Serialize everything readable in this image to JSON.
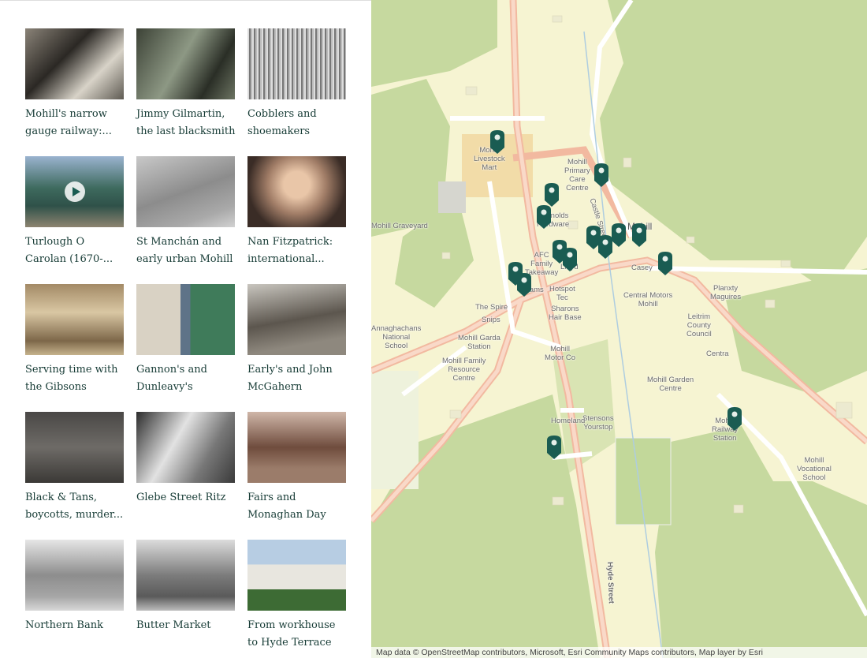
{
  "stories": [
    {
      "title": "Mohill's narrow gauge railway:...",
      "bg": "linear-gradient(135deg,#8a8378,#2b2824 40%,#d8d3c8 70%,#5e5a52)"
    },
    {
      "title": "Jimmy Gilmartin, the last blacksmith",
      "bg": "linear-gradient(120deg,#3c4236,#8d9884 45%,#2a2e26 75%,#6c7462)"
    },
    {
      "title": "Cobblers and shoemakers",
      "bg": "repeating-linear-gradient(90deg,#ddd 0 2px,#777 2px 4px,#bbb 4px 6px)"
    },
    {
      "title": "Turlough O Carolan (1670-...",
      "bg": "linear-gradient(180deg,#9ab3cf,#3e6a5e 45%,#2f5149 70%,#8d8470)",
      "video": true
    },
    {
      "title": "St Manchán and early urban Mohill",
      "bg": "linear-gradient(160deg,#c8c8c8,#8c8c8c 50%,#a9a9a9 80%,#d2d2d2)"
    },
    {
      "title": "Nan Fitzpatrick: international...",
      "bg": "radial-gradient(circle at 50% 40%,#e9c6a8 20%,#a17d67 45%,#3a2c26 75%)"
    },
    {
      "title": "Serving time with the Gibsons",
      "bg": "linear-gradient(180deg,#a38a66,#d9c7a3 40%,#7d6749 80%,#c5b28c)"
    },
    {
      "title": "Gannon's and Dunleavy's",
      "bg": "linear-gradient(90deg,#d9d2c4 0 45%,#5e7388 45% 55%,#3f7b5a 55% 100%)"
    },
    {
      "title": "Early's and John McGahern",
      "bg": "linear-gradient(170deg,#c9c6bf,#5c564e 50%,#8e887e 80%)"
    },
    {
      "title": "Black & Tans, boycotts, murder...",
      "bg": "linear-gradient(180deg,#4a4846,#6e6b67 50%,#3b3936)"
    },
    {
      "title": "Glebe Street Ritz",
      "bg": "linear-gradient(120deg,#2c2c2c,#e2e2e2 40%,#777 70%,#3a3a3a)"
    },
    {
      "title": "Fairs and Monaghan Day",
      "bg": "linear-gradient(180deg,#cfb6a8,#6f4c3d 50%,#9b7c6a 80%)"
    },
    {
      "title": "Northern Bank",
      "bg": "linear-gradient(180deg,#e6e6e6,#8d8d8d 50%,#a6a6a6 80%,#d8d8d8)"
    },
    {
      "title": "Butter Market",
      "bg": "linear-gradient(180deg,#dcdcdc,#7c7c7c 50%,#5a5a5a 80%,#bcbcbc)"
    },
    {
      "title": "From workhouse to Hyde Terrace",
      "bg": "linear-gradient(180deg,#b7cde3 0 35%,#e8e6df 35% 70%,#3d6b34 70%)"
    }
  ],
  "map": {
    "labels": [
      "Mohill Livestock Mart",
      "Mohill Primary Care Centre",
      "Reynolds Hardware",
      "Castle Street",
      "Mohill",
      "AFC Family Takeaway",
      "Lloyd",
      "Casey",
      "Hotspot Tec",
      "Zams",
      "The Spire",
      "Snips",
      "Sharons Hair Base",
      "Central Motors Mohill",
      "Planxty Maguires",
      "Leitrim County Council",
      "Mohill Garda Station",
      "Mohill Motor Co",
      "Centra",
      "Mohill Family Resource Centre",
      "Mohill Garden Centre",
      "Stensons Yourstop",
      "Homeland",
      "Mohill Railway Station",
      "Mohill Vocational School",
      "Hyde Street",
      "Mohill Graveyard",
      "Annaghachans National School"
    ],
    "attribution": "Map data © OpenStreetMap contributors, Microsoft, Esri Community Maps contributors, Map layer by Esri",
    "pin_color": "#1a5c52"
  }
}
